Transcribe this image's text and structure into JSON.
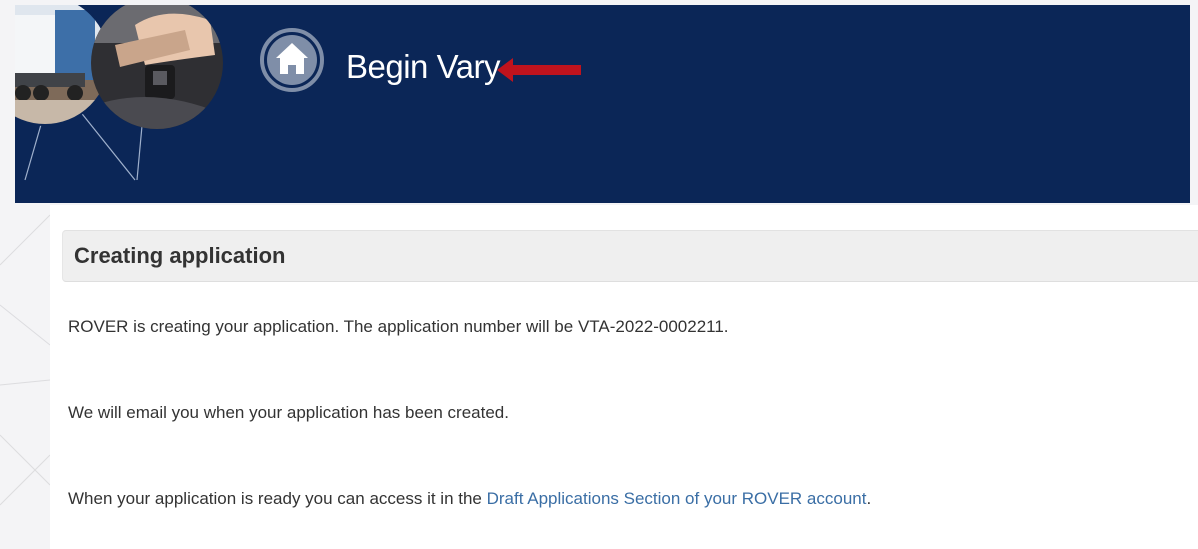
{
  "header": {
    "title": "Begin Vary",
    "background_color": "#0b2657",
    "home_icon": "home-icon",
    "arrow_icon": "red-arrow-left-icon",
    "arrow_color": "#c0131d"
  },
  "section": {
    "heading": "Creating application"
  },
  "messages": {
    "creating": "ROVER is creating your application. The application number will be VTA-2022-0002211.",
    "email": "We will email you when your application has been created.",
    "ready_prefix": "When your application is ready you can access it in the ",
    "ready_link": "Draft Applications Section of your ROVER account",
    "ready_suffix": "."
  },
  "colors": {
    "link": "#3a6ea5",
    "text": "#333333",
    "heading_bar": "#efefef"
  }
}
